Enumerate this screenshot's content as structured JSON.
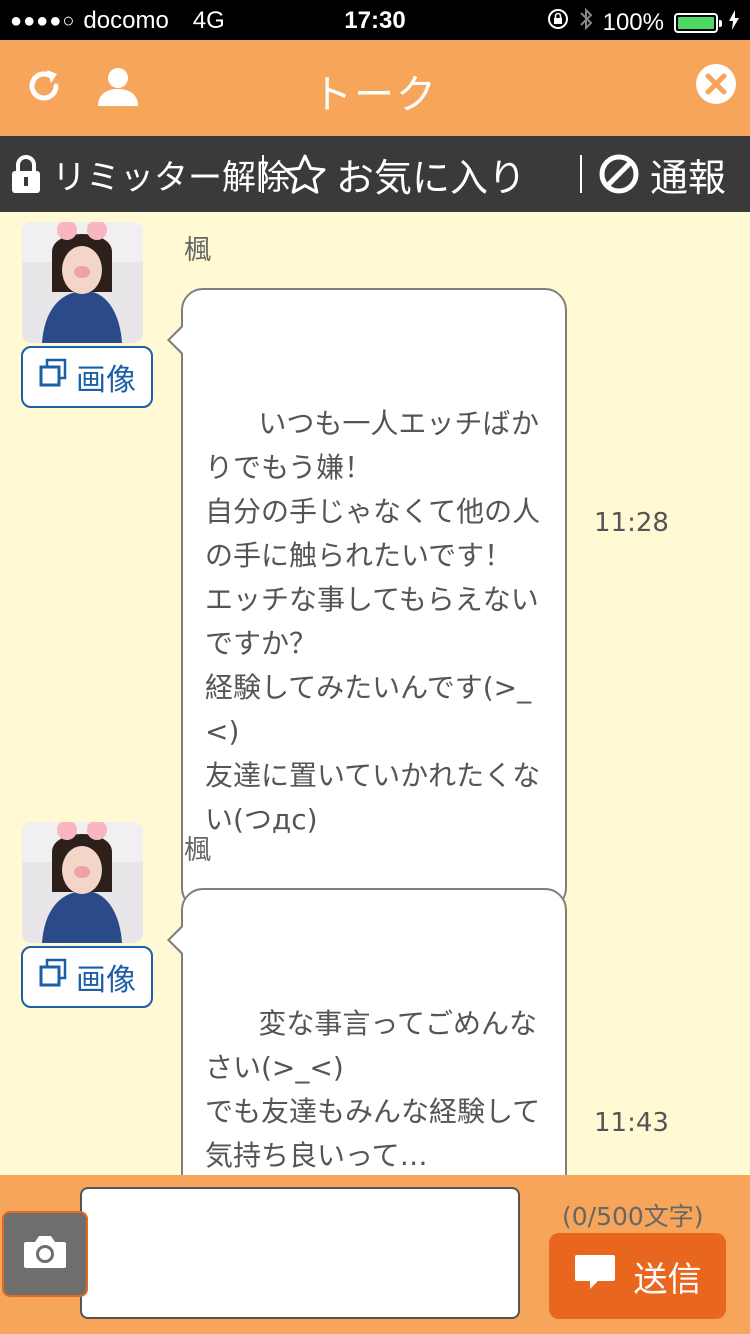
{
  "status_bar": {
    "carrier": "docomo",
    "network": "4G",
    "time": "17:30",
    "battery": "100%"
  },
  "header": {
    "title": "トーク"
  },
  "actions": {
    "limiter": "リミッター解除",
    "favorite": "お気に入り",
    "report": "通報"
  },
  "messages": [
    {
      "sender": "楓",
      "image_button": "画像",
      "text": "いつも一人エッチばかりでもう嫌！\n自分の手じゃなくて他の人の手に触られたいです！\nエッチな事してもらえないですか？\n経験してみたいんです(>_<)\n友達に置いていかれたくない(つдc)",
      "time": "11:28"
    },
    {
      "sender": "楓",
      "image_button": "画像",
      "text": "変な事言ってごめんなさい(>_<)\nでも友達もみんな経験して気持ち良いって…\n道具も自分が使うより目隠しされて使われるのがヤバいって言ってたし",
      "time": "11:43"
    }
  ],
  "input_bar": {
    "char_count": "(0/500文字)",
    "send_label": "送信",
    "input_value": ""
  },
  "colors": {
    "header": "#f6a55a",
    "action_bar": "#3a3a3a",
    "chat_background": "#fffad3",
    "send_button": "#e8661e",
    "image_button": "#1b5fa8"
  }
}
